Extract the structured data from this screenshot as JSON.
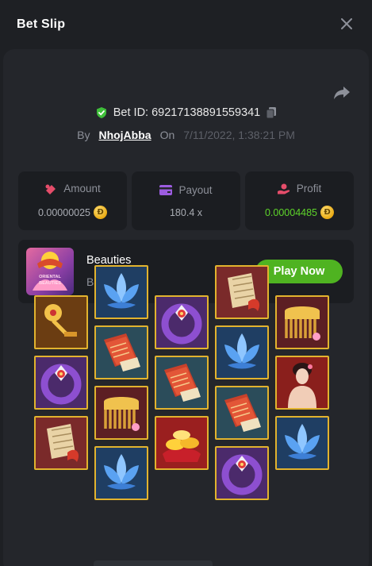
{
  "header": {
    "title": "Bet Slip",
    "close_icon": "close-icon"
  },
  "bet": {
    "id_label": "Bet ID: 69217138891559341",
    "by_label": "By",
    "username": "NhojAbba",
    "on_label": "On",
    "date": "7/11/2022, 1:38:21 PM"
  },
  "stats": [
    {
      "label": "Amount",
      "value": "0.00000025",
      "icon": "amount-icon",
      "coin": "Ð"
    },
    {
      "label": "Payout",
      "value": "180.4 x",
      "icon": "payout-icon"
    },
    {
      "label": "Profit",
      "value": "0.00004485",
      "icon": "profit-icon",
      "coin": "Ð"
    }
  ],
  "game": {
    "name": "Beauties",
    "provider": "BC Original",
    "play_label": "Play Now",
    "thumb_text_top": "ORIENTAL",
    "thumb_text_bottom": "BEAUTIES"
  },
  "colors": {
    "accent_green": "#4fb321",
    "profit_green": "#5ed42a",
    "tile_border": "#e2b32e",
    "background": "#1e2024"
  },
  "reels": [
    [
      "pin",
      "ring",
      "scroll"
    ],
    [
      "lotus",
      "book",
      "comb",
      "lotus"
    ],
    [
      "ring",
      "book",
      "gold"
    ],
    [
      "scroll",
      "lotus",
      "book",
      "ring"
    ],
    [
      "comb",
      "lady",
      "lotus"
    ]
  ]
}
